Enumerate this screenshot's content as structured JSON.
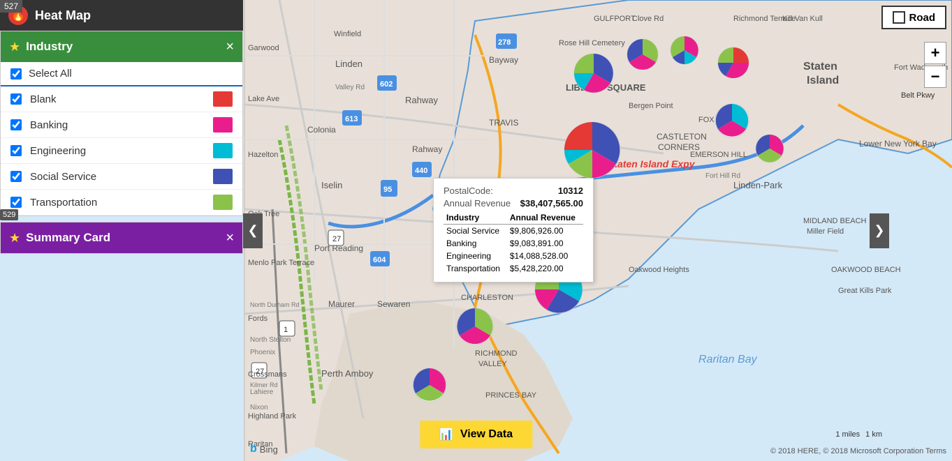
{
  "header": {
    "title": "Heat Map",
    "fire_icon": "🔥"
  },
  "industry_panel": {
    "title": "Industry",
    "star_icon": "★",
    "close_label": "×",
    "select_all_label": "Select All",
    "items": [
      {
        "name": "Blank",
        "color": "#e53935",
        "checked": true
      },
      {
        "name": "Banking",
        "color": "#e91e8c",
        "checked": true
      },
      {
        "name": "Engineering",
        "color": "#00bcd4",
        "checked": true
      },
      {
        "name": "Social Service",
        "color": "#3f51b5",
        "checked": true
      },
      {
        "name": "Transportation",
        "color": "#8bc34a",
        "checked": true
      }
    ]
  },
  "summary_panel": {
    "title": "Summary Card",
    "star_icon": "★",
    "close_label": "×"
  },
  "tooltip": {
    "postal_code_label": "PostalCode:",
    "postal_code_value": "10312",
    "annual_revenue_label": "Annual Revenue",
    "annual_revenue_value": "$38,407,565.00",
    "table_headers": [
      "Industry",
      "Annual Revenue"
    ],
    "rows": [
      {
        "industry": "Social Service",
        "revenue": "$9,806,926.00"
      },
      {
        "industry": "Banking",
        "revenue": "$9,083,891.00"
      },
      {
        "industry": "Engineering",
        "revenue": "$14,088,528.00"
      },
      {
        "industry": "Transportation",
        "revenue": "$5,428,220.00"
      }
    ]
  },
  "buttons": {
    "road_label": "Road",
    "view_data_label": "View Data",
    "zoom_in": "+",
    "zoom_out": "−",
    "nav_left": "❮",
    "nav_right": "❯"
  },
  "map": {
    "scale_miles": "1 miles",
    "scale_km": "1 km",
    "copyright": "© 2018 HERE, © 2018 Microsoft Corporation Terms",
    "bing_label": "Bing"
  },
  "badges": {
    "badge_527": "527",
    "badge_529": "529"
  }
}
